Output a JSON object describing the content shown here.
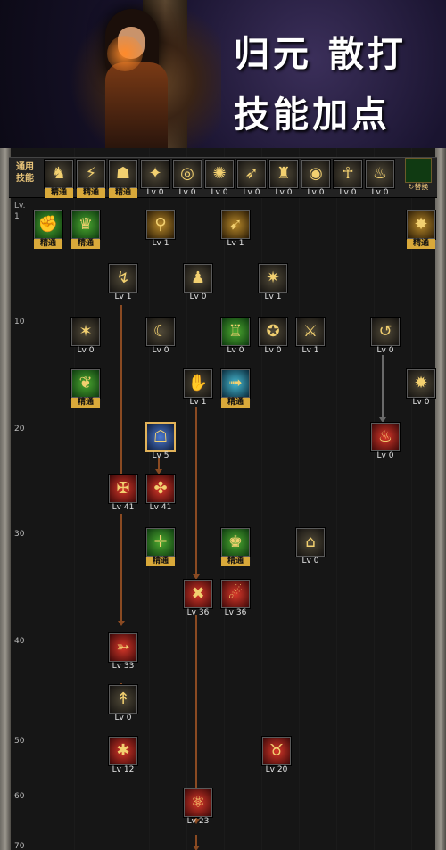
{
  "banner": {
    "title_line1": "归元 散打",
    "title_line2": "技能加点"
  },
  "tree": {
    "common_label": "通用\n技能",
    "swap_label": "↻替换",
    "lv_header": "Lv.",
    "level_markers": [
      "1",
      "10",
      "20",
      "30",
      "40",
      "50",
      "60",
      "70"
    ],
    "top_row": [
      {
        "icon": "stance-icon",
        "label": "精通"
      },
      {
        "icon": "kick-icon",
        "label": "精通"
      },
      {
        "icon": "power-icon",
        "label": "精通"
      },
      {
        "icon": "wing-icon",
        "label": "Lv 0"
      },
      {
        "icon": "target-icon",
        "label": "Lv 0"
      },
      {
        "icon": "aura-icon",
        "label": "Lv 0"
      },
      {
        "icon": "leap-icon",
        "label": "Lv 0"
      },
      {
        "icon": "fighter-icon",
        "label": "Lv 0"
      },
      {
        "icon": "shield-icon",
        "label": "Lv 0"
      },
      {
        "icon": "figure-icon",
        "label": "Lv 0"
      },
      {
        "icon": "flame-icon",
        "label": "Lv 0"
      }
    ],
    "skills": [
      {
        "icon": "brawl-icon",
        "label": "精通",
        "theme": "green"
      },
      {
        "icon": "grapple-icon",
        "label": "精通",
        "theme": "green"
      },
      {
        "icon": "bag-icon",
        "label": "Lv 1",
        "theme": "gold"
      },
      {
        "icon": "throw-icon",
        "label": "Lv 1",
        "theme": "gold"
      },
      {
        "icon": "burst-icon",
        "label": "精通",
        "theme": "gold"
      },
      {
        "icon": "uppercut-icon",
        "label": "Lv 1",
        "theme": "dark"
      },
      {
        "icon": "muscle-icon",
        "label": "Lv 0",
        "theme": "dark"
      },
      {
        "icon": "flare-icon",
        "label": "Lv 1",
        "theme": "dark"
      },
      {
        "icon": "spark-icon",
        "label": "Lv 0",
        "theme": "dark"
      },
      {
        "icon": "swipe-icon",
        "label": "Lv 0",
        "theme": "dark"
      },
      {
        "icon": "armor-icon",
        "label": "Lv 0",
        "theme": "green"
      },
      {
        "icon": "smash-icon",
        "label": "Lv 0",
        "theme": "dark"
      },
      {
        "icon": "combo-icon",
        "label": "Lv 1",
        "theme": "dark"
      },
      {
        "icon": "spin-icon",
        "label": "Lv 0",
        "theme": "dark"
      },
      {
        "icon": "leaf-icon",
        "label": "精通",
        "theme": "green"
      },
      {
        "icon": "fist-icon",
        "label": "Lv 1",
        "theme": "dark"
      },
      {
        "icon": "dash-icon",
        "label": "精通",
        "theme": "cyan"
      },
      {
        "icon": "blast-icon",
        "label": "Lv 0",
        "theme": "dark"
      },
      {
        "icon": "guard-icon",
        "label": "Lv 5",
        "theme": "blue"
      },
      {
        "icon": "fire-icon",
        "label": "Lv 0",
        "theme": "red"
      },
      {
        "icon": "fury-icon",
        "label": "Lv 41",
        "theme": "red"
      },
      {
        "icon": "rage-icon",
        "label": "Lv 41",
        "theme": "red"
      },
      {
        "icon": "radar-icon",
        "label": "精通",
        "theme": "green"
      },
      {
        "icon": "titan-icon",
        "label": "精通",
        "theme": "green"
      },
      {
        "icon": "floor-icon",
        "label": "Lv 0",
        "theme": "dark"
      },
      {
        "icon": "break-icon",
        "label": "Lv 36",
        "theme": "red"
      },
      {
        "icon": "hook-icon",
        "label": "Lv 36",
        "theme": "red"
      },
      {
        "icon": "slash-icon",
        "label": "Lv 33",
        "theme": "red"
      },
      {
        "icon": "kick2-icon",
        "label": "Lv 0",
        "theme": "dark"
      },
      {
        "icon": "explode-icon",
        "label": "Lv 12",
        "theme": "red"
      },
      {
        "icon": "beast-icon",
        "label": "Lv 20",
        "theme": "red"
      },
      {
        "icon": "ultimate-icon",
        "label": "Lv 23",
        "theme": "red"
      }
    ]
  }
}
